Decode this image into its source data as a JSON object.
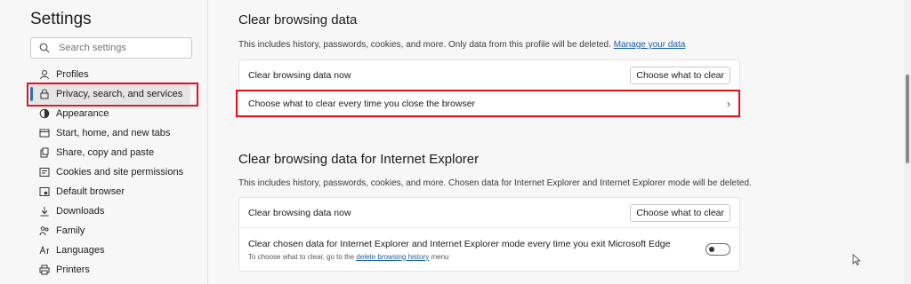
{
  "sidebar": {
    "title": "Settings",
    "search_placeholder": "Search settings",
    "items": [
      {
        "label": "Profiles",
        "icon": "profile-icon"
      },
      {
        "label": "Privacy, search, and services",
        "icon": "lock-icon",
        "active": true
      },
      {
        "label": "Appearance",
        "icon": "appearance-icon"
      },
      {
        "label": "Start, home, and new tabs",
        "icon": "home-tabs-icon"
      },
      {
        "label": "Share, copy and paste",
        "icon": "share-icon"
      },
      {
        "label": "Cookies and site permissions",
        "icon": "cookies-icon"
      },
      {
        "label": "Default browser",
        "icon": "browser-icon"
      },
      {
        "label": "Downloads",
        "icon": "download-icon"
      },
      {
        "label": "Family",
        "icon": "family-icon"
      },
      {
        "label": "Languages",
        "icon": "language-icon"
      },
      {
        "label": "Printers",
        "icon": "printer-icon"
      }
    ]
  },
  "clear_data": {
    "title": "Clear browsing data",
    "desc": "This includes history, passwords, cookies, and more. Only data from this profile will be deleted.",
    "manage_link": "Manage your data",
    "row_now_label": "Clear browsing data now",
    "row_now_button": "Choose what to clear",
    "row_every_label": "Choose what to clear every time you close the browser"
  },
  "ie_data": {
    "title": "Clear browsing data for Internet Explorer",
    "desc": "This includes history, passwords, cookies, and more. Chosen data for Internet Explorer and Internet Explorer mode will be deleted.",
    "row_now_label": "Clear browsing data now",
    "row_now_button": "Choose what to clear",
    "row_exit_label": "Clear chosen data for Internet Explorer and Internet Explorer mode every time you exit Microsoft Edge",
    "row_exit_note_prefix": "To choose what to clear, go to the",
    "row_exit_note_link": "delete browsing history",
    "row_exit_note_suffix": "menu",
    "toggle_on": false
  },
  "colors": {
    "accent": "#2a6fbb",
    "highlight": "#e0121c",
    "link": "#1a5fa8"
  }
}
